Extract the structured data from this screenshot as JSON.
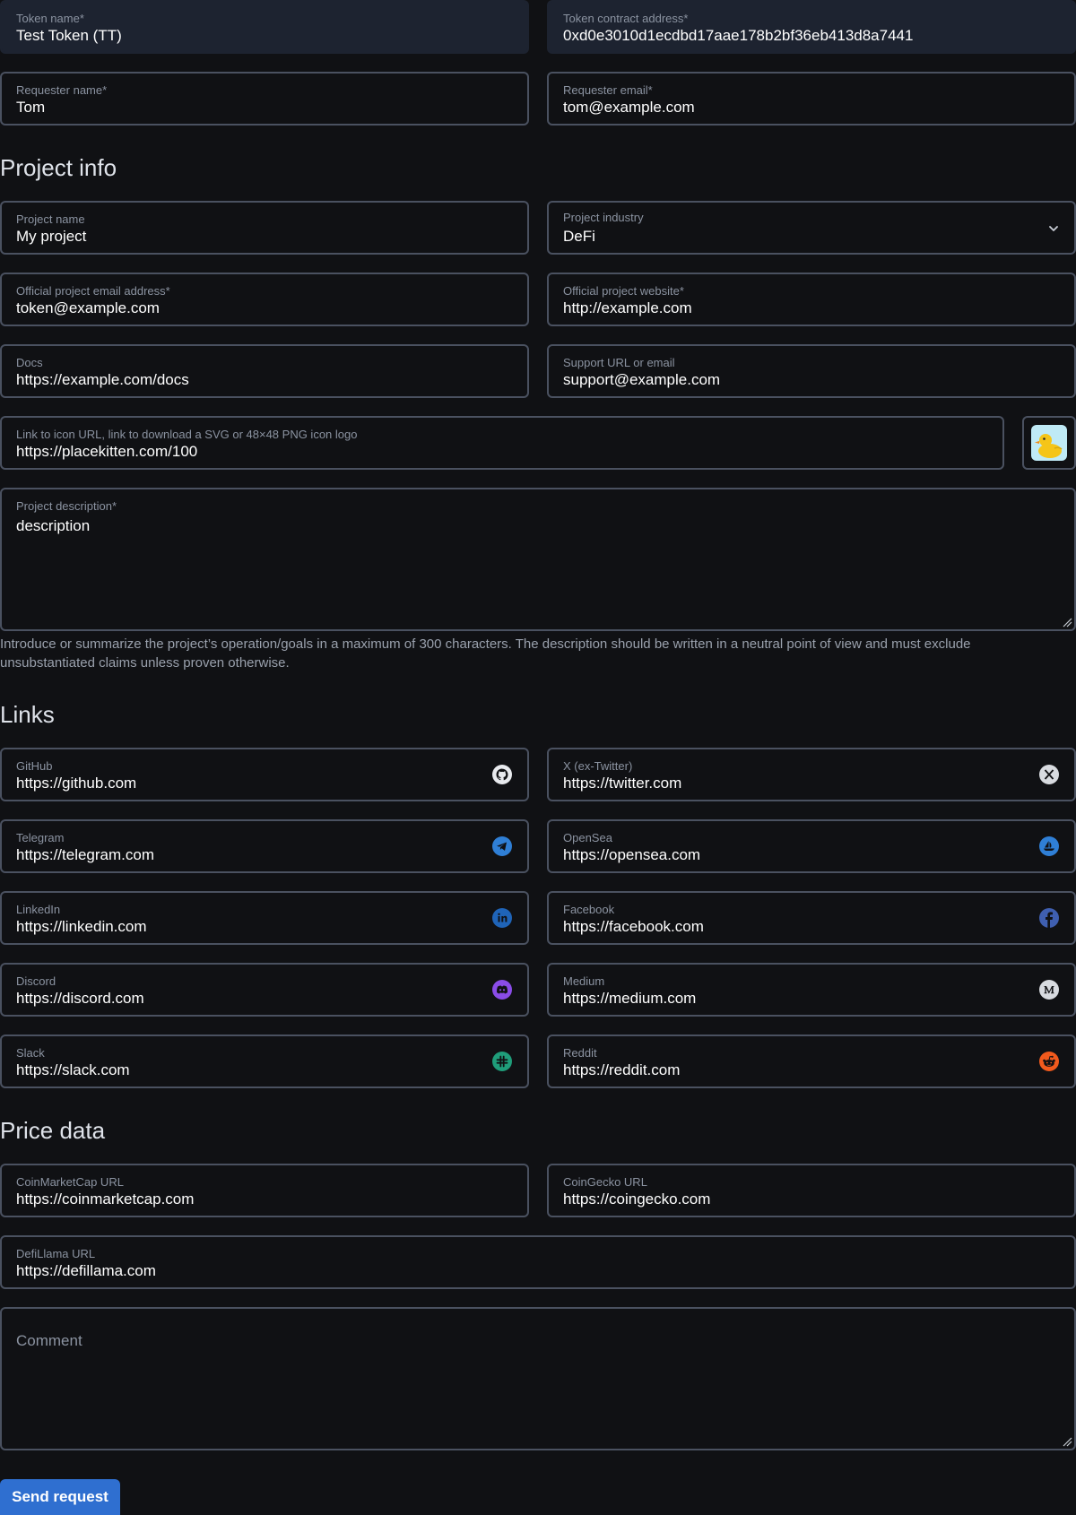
{
  "token": {
    "name_label": "Token name*",
    "name_value": "Test Token (TT)",
    "address_label": "Token contract address*",
    "address_value": "0xd0e3010d1ecdbd17aae178b2bf36eb413d8a7441"
  },
  "requester": {
    "name_label": "Requester name*",
    "name_value": "Tom",
    "email_label": "Requester email*",
    "email_value": "tom@example.com"
  },
  "project_info": {
    "heading": "Project info",
    "name_label": "Project name",
    "name_value": "My project",
    "industry_label": "Project industry",
    "industry_value": "DeFi",
    "email_label": "Official project email address*",
    "email_value": "token@example.com",
    "website_label": "Official project website*",
    "website_value": "http://example.com",
    "docs_label": "Docs",
    "docs_value": "https://example.com/docs",
    "support_label": "Support URL or email",
    "support_value": "support@example.com",
    "icon_label": "Link to icon URL, link to download a SVG or 48×48 PNG icon logo",
    "icon_value": "https://placekitten.com/100",
    "description_label": "Project description*",
    "description_value": "description",
    "description_hint": "Introduce or summarize the project’s operation/goals in a maximum of 300 characters. The description should be written in a neutral point of view and must exclude unsubstantiated claims unless proven otherwise."
  },
  "links": {
    "heading": "Links",
    "items": [
      {
        "label": "GitHub",
        "value": "https://github.com",
        "icon": "github-icon"
      },
      {
        "label": "X (ex-Twitter)",
        "value": "https://twitter.com",
        "icon": "x-icon"
      },
      {
        "label": "Telegram",
        "value": "https://telegram.com",
        "icon": "telegram-icon"
      },
      {
        "label": "OpenSea",
        "value": "https://opensea.com",
        "icon": "opensea-icon"
      },
      {
        "label": "LinkedIn",
        "value": "https://linkedin.com",
        "icon": "linkedin-icon"
      },
      {
        "label": "Facebook",
        "value": "https://facebook.com",
        "icon": "facebook-icon"
      },
      {
        "label": "Discord",
        "value": "https://discord.com",
        "icon": "discord-icon"
      },
      {
        "label": "Medium",
        "value": "https://medium.com",
        "icon": "medium-icon"
      },
      {
        "label": "Slack",
        "value": "https://slack.com",
        "icon": "slack-icon"
      },
      {
        "label": "Reddit",
        "value": "https://reddit.com",
        "icon": "reddit-icon"
      }
    ]
  },
  "price_data": {
    "heading": "Price data",
    "cmc_label": "CoinMarketCap URL",
    "cmc_value": "https://coinmarketcap.com",
    "coingecko_label": "CoinGecko URL",
    "coingecko_value": "https://coingecko.com",
    "defillama_label": "DefiLlama URL",
    "defillama_value": "https://defillama.com"
  },
  "comment": {
    "placeholder": "Comment"
  },
  "submit": {
    "label": "Send request"
  },
  "colors": {
    "accent": "#2f6fd0",
    "background": "#101114",
    "border": "#4a5160",
    "readonly_bg": "#1d2330",
    "telegram": "#2f7fd6",
    "opensea": "#2f7fd6",
    "linkedin": "#1f64b8",
    "facebook": "#3f5fb0",
    "discord": "#8a4ce8",
    "slack": "#1f9d7a",
    "reddit": "#f25a1d"
  }
}
